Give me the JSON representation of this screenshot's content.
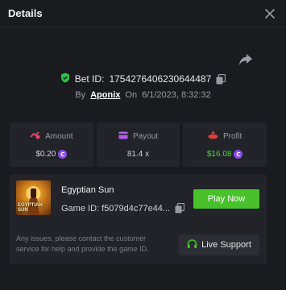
{
  "header": {
    "title": "Details"
  },
  "bet": {
    "id_label": "Bet ID:",
    "id_value": "1754276406230644487",
    "by_label": "By",
    "username": "Aponix",
    "on_label": "On",
    "datetime": "6/1/2023, 8:32:32"
  },
  "stats": [
    {
      "label": "Amount",
      "value": "$0.20",
      "coin": "C"
    },
    {
      "label": "Payout",
      "value": "81.4 x"
    },
    {
      "label": "Profit",
      "value": "$16.08",
      "coin": "C"
    }
  ],
  "game": {
    "thumb_text_1": "EGYPTIAN",
    "thumb_text_2": "SUN",
    "name": "Egyptian Sun",
    "id_label": "Game ID:",
    "id_value": "f5079d4c77e44...",
    "play_label": "Play Now"
  },
  "support": {
    "notice": "Any issues, please contact the customer service for help and provide the game ID.",
    "button_label": "Live Support"
  },
  "colors": {
    "accent_green": "#49c12a",
    "profit_green": "#52d33a",
    "coin_purple": "#8a4cf0",
    "verified_green": "#2fc24a"
  }
}
